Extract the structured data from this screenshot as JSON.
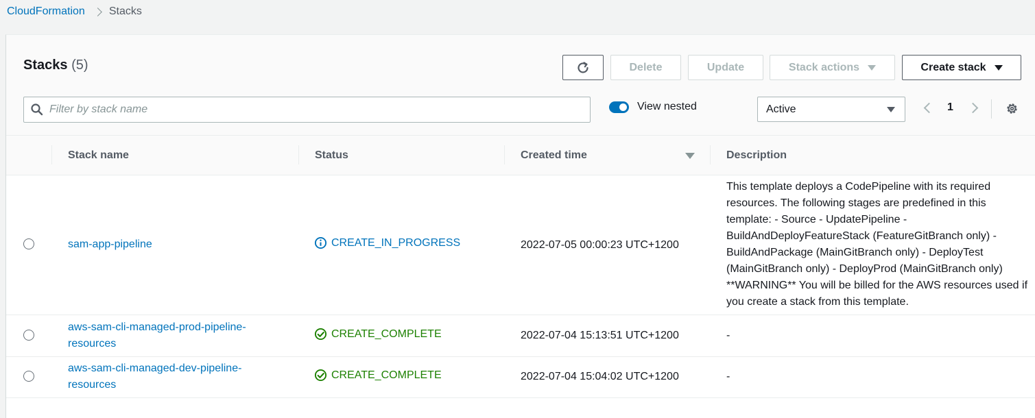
{
  "breadcrumb": {
    "parent": "CloudFormation",
    "current": "Stacks"
  },
  "header": {
    "title": "Stacks",
    "count": "(5)"
  },
  "toolbar": {
    "delete_label": "Delete",
    "update_label": "Update",
    "stack_actions_label": "Stack actions",
    "create_stack_label": "Create stack"
  },
  "filter": {
    "placeholder": "Filter by stack name",
    "value": ""
  },
  "view_nested": {
    "label": "View nested",
    "enabled": true
  },
  "status_filter": {
    "selected": "Active"
  },
  "pagination": {
    "current_page": "1"
  },
  "table": {
    "columns": [
      "Stack name",
      "Status",
      "Created time",
      "Description"
    ],
    "rows": [
      {
        "name": "sam-app-pipeline",
        "status": "CREATE_IN_PROGRESS",
        "created": "2022-07-05 00:00:23 UTC+1200",
        "description": "This template deploys a CodePipeline with its required resources. The following stages are predefined in this template: - Source - UpdatePipeline - BuildAndDeployFeatureStack (FeatureGitBranch only) - BuildAndPackage (MainGitBranch only) - DeployTest (MainGitBranch only) - DeployProd (MainGitBranch only) **WARNING** You will be billed for the AWS resources used if you create a stack from this template."
      },
      {
        "name": "aws-sam-cli-managed-prod-pipeline-resources",
        "status": "CREATE_COMPLETE",
        "created": "2022-07-04 15:13:51 UTC+1200",
        "description": "-"
      },
      {
        "name": "aws-sam-cli-managed-dev-pipeline-resources",
        "status": "CREATE_COMPLETE",
        "created": "2022-07-04 15:04:02 UTC+1200",
        "description": "-"
      }
    ]
  },
  "colors": {
    "link": "#0073bb",
    "success": "#1d8102",
    "in_progress": "#0073bb",
    "toggle_on": "#0073bb"
  },
  "icons": [
    "refresh-icon",
    "caret-down-icon",
    "search-icon",
    "chevron-left-icon",
    "chevron-right-icon",
    "gear-icon",
    "info-icon",
    "check-circle-icon",
    "sort-caret-icon"
  ]
}
